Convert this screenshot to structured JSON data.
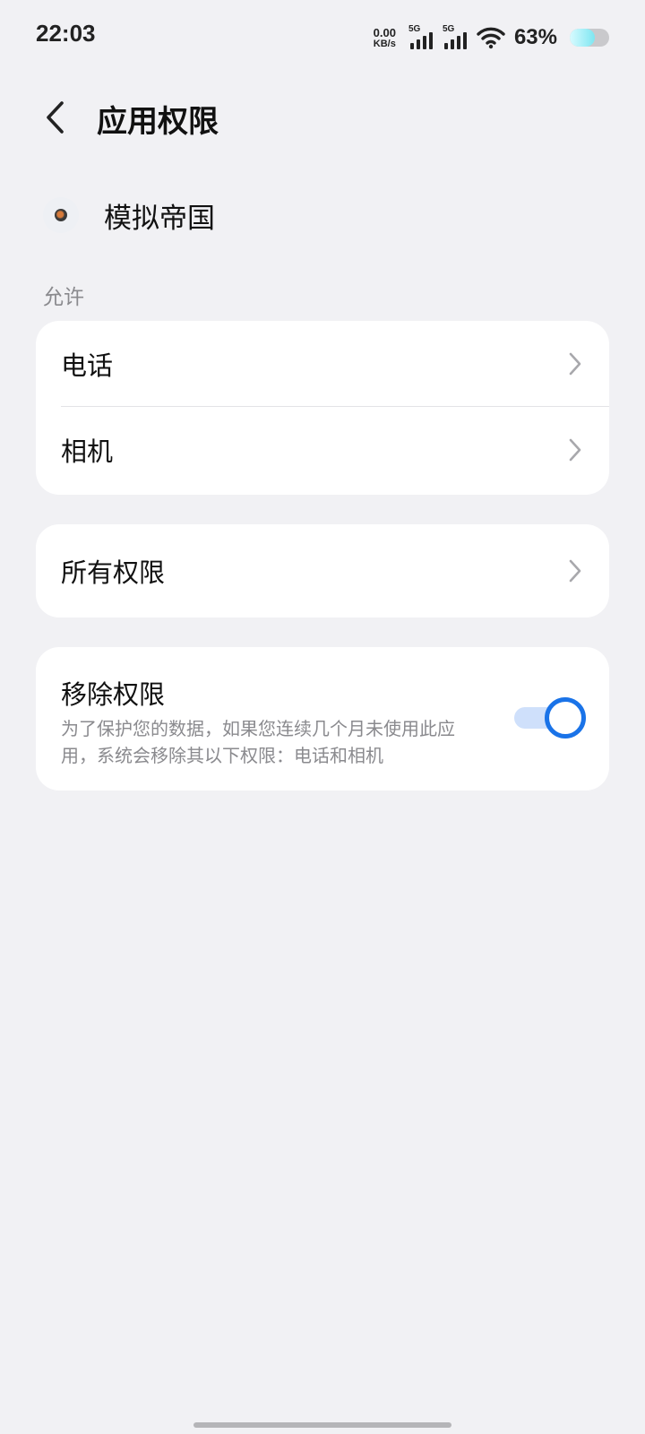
{
  "status_bar": {
    "time": "22:03",
    "net_speed_value": "0.00",
    "net_speed_unit": "KB/s",
    "signal1_label": "5G",
    "signal2_label": "5G",
    "battery_percent": "63%",
    "battery_level": 0.63,
    "icons": [
      "signal-icon",
      "wifi-icon",
      "battery-icon"
    ]
  },
  "header": {
    "title": "应用权限",
    "back_icon": "back-arrow-icon"
  },
  "app": {
    "name": "模拟帝国",
    "icon": "app-icon"
  },
  "section_label": "允许",
  "allowed_permissions": [
    {
      "label": "电话"
    },
    {
      "label": "相机"
    }
  ],
  "all_permissions": {
    "label": "所有权限"
  },
  "remove_permissions": {
    "title": "移除权限",
    "description": "为了保护您的数据，如果您连续几个月未使用此应用，系统会移除其以下权限：电话和相机",
    "toggle_on": true
  },
  "colors": {
    "accent": "#1a73e8",
    "background": "#f1f1f4",
    "card": "#ffffff",
    "secondary_text": "#8a8a8e"
  }
}
